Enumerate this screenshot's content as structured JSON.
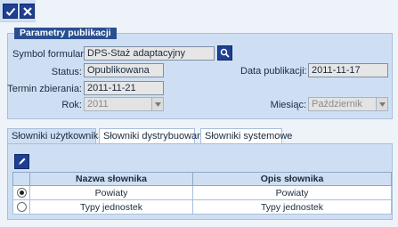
{
  "toolbar": {
    "apply_icon": "checkmark-icon",
    "cancel_icon": "close-x-icon"
  },
  "params": {
    "title": "Parametry publikacji",
    "symbol_label": "Symbol formularza:",
    "symbol_value": "DPS-Staż adaptacyjny",
    "status_label": "Status:",
    "status_value": "Opublikowana",
    "date_label": "Data publikacji:",
    "date_value": "2011-11-17",
    "term_label": "Termin zbierania:",
    "term_value": "2011-11-21",
    "year_label": "Rok:",
    "year_value": "2011",
    "month_label": "Miesiąc:",
    "month_value": "Październik"
  },
  "tabs": [
    {
      "label": "Słowniki użytkownika",
      "active": true
    },
    {
      "label": "Słowniki dystrybuowane",
      "active": false
    },
    {
      "label": "Słowniki systemowe",
      "active": false
    }
  ],
  "table": {
    "headers": [
      "",
      "Nazwa słownika",
      "Opis słownika"
    ],
    "rows": [
      {
        "selected": true,
        "name": "Powiaty",
        "desc": "Powiaty"
      },
      {
        "selected": false,
        "name": "Typy jednostek",
        "desc": "Typy jednostek"
      }
    ]
  },
  "colors": {
    "accent": "#1f3f92",
    "panel": "#cfdff3",
    "title_bar": "#2a4f8f"
  }
}
